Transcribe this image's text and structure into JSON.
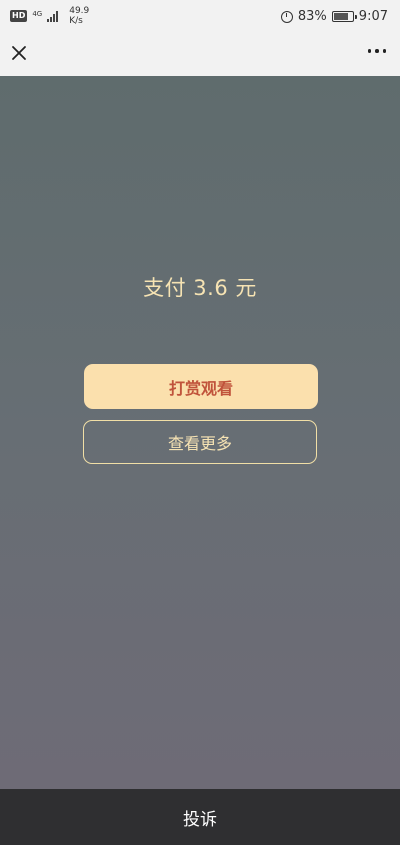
{
  "status_bar": {
    "hd_label": "HD",
    "network_label": "4G",
    "net_speed_value": "49.9",
    "net_speed_unit": "K/s",
    "battery_percent": "83%",
    "battery_level": 0.83,
    "time": "9:07"
  },
  "nav": {
    "close_icon": "close-icon",
    "more_icon": "more-icon"
  },
  "paywall": {
    "pay_text": "支付 3.6 元",
    "reward_button_label": "打赏观看",
    "more_button_label": "查看更多"
  },
  "footer": {
    "complain_label": "投诉"
  },
  "colors": {
    "gold_text": "#f6e3b3",
    "reward_bg": "#fbe0ad",
    "reward_text": "#c0533b",
    "footer_bg": "#2f2f31"
  }
}
